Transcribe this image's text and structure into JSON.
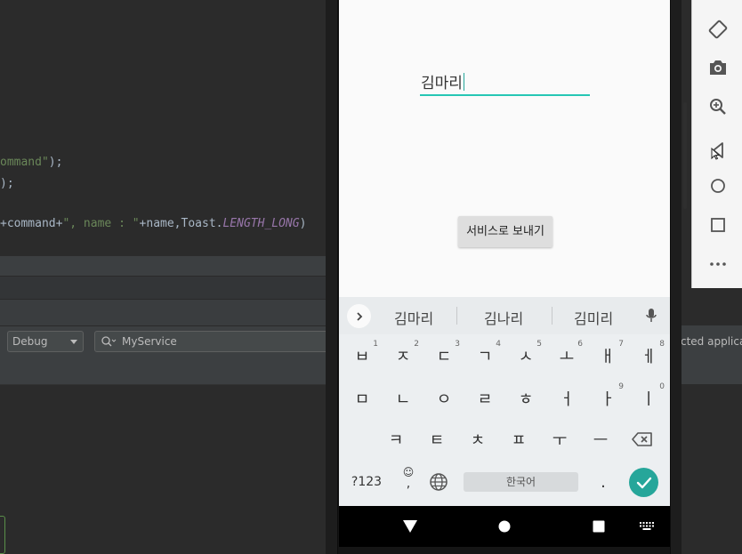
{
  "editor": {
    "line1": {
      "str": "ommand\"",
      "tail": ");"
    },
    "line2": {
      "tail": ");"
    },
    "line3": {
      "op1": "+command+",
      "str1": "\", name : \"",
      "op2": "+name,Toast.",
      "ital": "LENGTH_LONG",
      "tail": ")"
    }
  },
  "toolbar": {
    "config_select": "Debug",
    "search_value": "MyService",
    "right_text": "cted applicat"
  },
  "emulator_panel": {
    "icons": [
      "rotate-icon",
      "camera-icon",
      "zoom-icon",
      "back-icon",
      "home-icon",
      "overview-icon",
      "more-icon"
    ]
  },
  "app": {
    "name_value": "김마리",
    "send_button": "서비스로 보내기",
    "accent_color": "#26c6b4"
  },
  "keyboard": {
    "suggestions": [
      "김마리",
      "김나리",
      "김미리"
    ],
    "row1": [
      {
        "k": "ㅂ",
        "h": "1"
      },
      {
        "k": "ㅈ",
        "h": "2"
      },
      {
        "k": "ㄷ",
        "h": "3"
      },
      {
        "k": "ㄱ",
        "h": "4"
      },
      {
        "k": "ㅅ",
        "h": "5"
      },
      {
        "k": "ㅗ",
        "h": "6"
      },
      {
        "k": "ㅐ",
        "h": "7"
      },
      {
        "k": "ㅔ",
        "h": "8"
      }
    ],
    "row2": [
      {
        "k": "ㅁ",
        "h": ""
      },
      {
        "k": "ㄴ",
        "h": ""
      },
      {
        "k": "ㅇ",
        "h": ""
      },
      {
        "k": "ㄹ",
        "h": ""
      },
      {
        "k": "ㅎ",
        "h": ""
      },
      {
        "k": "ㅓ",
        "h": ""
      },
      {
        "k": "ㅏ",
        "h": "9"
      },
      {
        "k": "ㅣ",
        "h": "0"
      }
    ],
    "row3": [
      "ㅋ",
      "ㅌ",
      "ㅊ",
      "ㅍ",
      "ㅜ",
      "ㅡ"
    ],
    "symbols_key": "?123",
    "emoji_key": "☺",
    "comma_key": ",",
    "space_label": "한국어",
    "period_key": "."
  }
}
